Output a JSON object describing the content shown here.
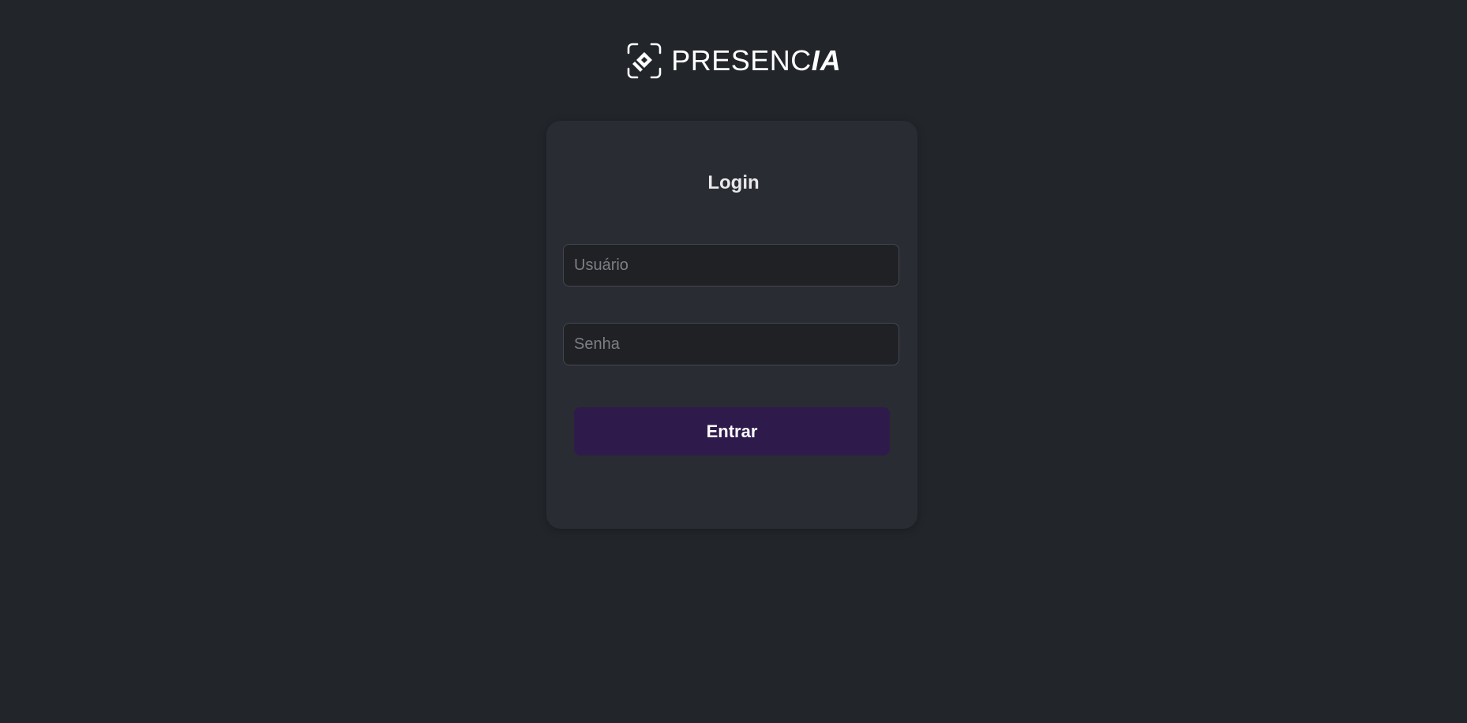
{
  "brand": {
    "name_light": "PRESENC",
    "name_bold": "IA",
    "logo_icon": "face-scan-logo-icon"
  },
  "login": {
    "title": "Login",
    "username": {
      "value": "",
      "placeholder": "Usuário"
    },
    "password": {
      "value": "",
      "placeholder": "Senha"
    },
    "submit_label": "Entrar"
  },
  "colors": {
    "background": "#22252a",
    "card": "#292c32",
    "input_bg": "#1f2125",
    "button": "#2f1b4b",
    "text": "#e8e8ea"
  }
}
